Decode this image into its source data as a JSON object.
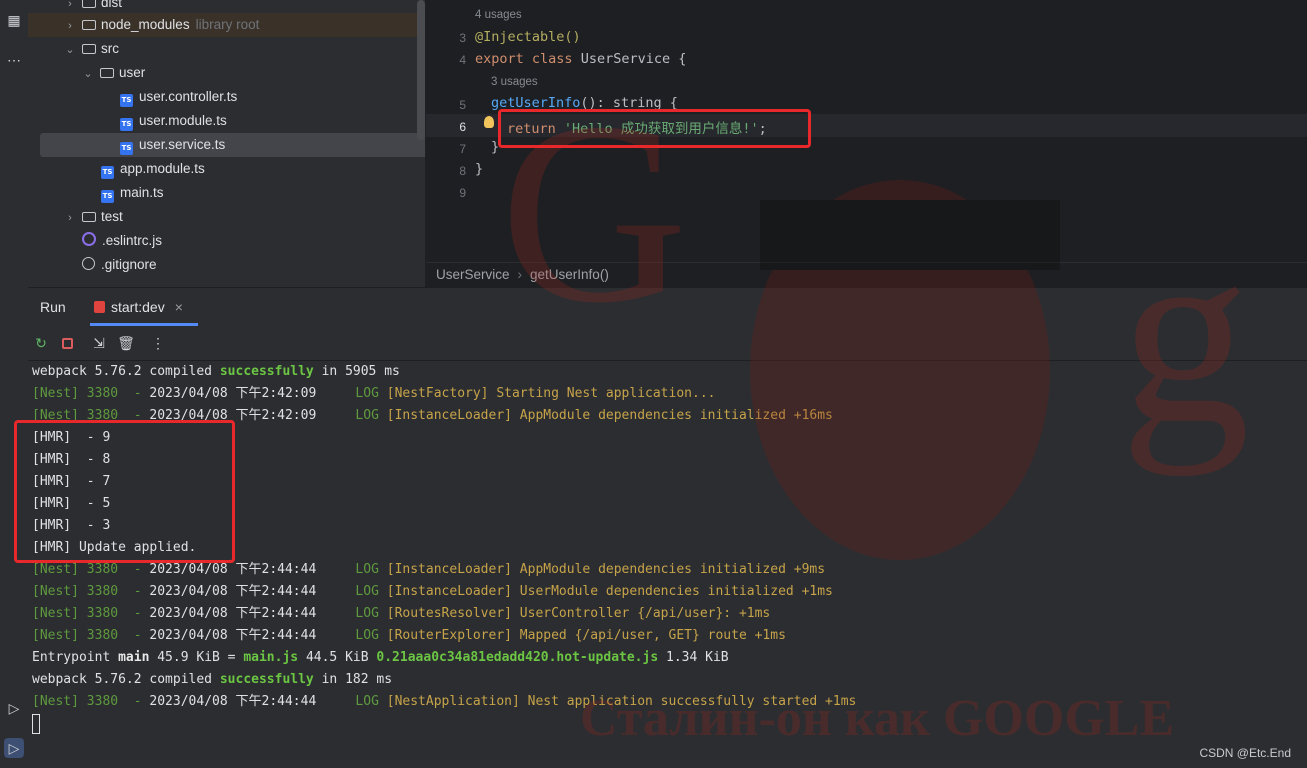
{
  "project_tree": {
    "items": [
      {
        "label": "dist",
        "kind": "folder",
        "depth": 1,
        "chevron": "›"
      },
      {
        "label": "node_modules",
        "tag": "library root",
        "kind": "folder",
        "depth": 1,
        "chevron": "›"
      },
      {
        "label": "src",
        "kind": "folder",
        "depth": 1,
        "chevron": "⌄"
      },
      {
        "label": "user",
        "kind": "folder",
        "depth": 2,
        "chevron": "⌄"
      },
      {
        "label": "user.controller.ts",
        "kind": "ts",
        "depth": 3
      },
      {
        "label": "user.module.ts",
        "kind": "ts",
        "depth": 3
      },
      {
        "label": "user.service.ts",
        "kind": "ts",
        "depth": 3,
        "selected": true
      },
      {
        "label": "app.module.ts",
        "kind": "ts",
        "depth": 2
      },
      {
        "label": "main.ts",
        "kind": "ts",
        "depth": 2
      },
      {
        "label": "test",
        "kind": "folder",
        "depth": 1,
        "chevron": "›"
      },
      {
        "label": ".eslintrc.js",
        "kind": "eslint",
        "depth": 1
      },
      {
        "label": ".gitignore",
        "kind": "ignore",
        "depth": 1
      }
    ]
  },
  "editor": {
    "usages_top": "4 usages",
    "usages_method": "3 usages",
    "line_numbers": [
      "3",
      "4",
      "5",
      "6",
      "7",
      "8",
      "9"
    ],
    "lines": {
      "l3_annotation": "@Injectable()",
      "l4_export": "export",
      "l4_class": "class",
      "l4_name": " UserService {",
      "l5_method": "getUserInfo",
      "l5_rest": "(): string {",
      "l6_return": "return",
      "l6_string": "'Hello 成功获取到用户信息!'",
      "l6_end": ";",
      "l7": "}",
      "l8": "}"
    },
    "breadcrumb": {
      "class": "UserService",
      "separator": "›",
      "method": "getUserInfo()"
    }
  },
  "run_panel": {
    "title": "Run",
    "tab_label": "start:dev",
    "tab_close": "×"
  },
  "console": {
    "webpack_1": {
      "pre": "webpack 5.76.2 compiled ",
      "status": "successfully",
      "post": " in 5905 ms"
    },
    "nest_1": {
      "prefix": "[Nest] 3380  - ",
      "time": "2023/04/08 下午2:42:09",
      "level": "     LOG ",
      "msg": "[NestFactory] Starting Nest application..."
    },
    "nest_2": {
      "prefix": "[Nest] 3380  - ",
      "time": "2023/04/08 下午2:42:09",
      "level": "     LOG ",
      "msg": "[InstanceLoader] AppModule dependencies initialized +16ms"
    },
    "hmr": [
      "[HMR]  - 9",
      "[HMR]  - 8",
      "[HMR]  - 7",
      "[HMR]  - 5",
      "[HMR]  - 3",
      "[HMR] Update applied."
    ],
    "nest_3": {
      "prefix": "[Nest] 3380  - ",
      "time": "2023/04/08 下午2:44:44",
      "level": "     LOG ",
      "msg": "[InstanceLoader] AppModule dependencies initialized +9ms"
    },
    "nest_4": {
      "prefix": "[Nest] 3380  - ",
      "time": "2023/04/08 下午2:44:44",
      "level": "     LOG ",
      "msg": "[InstanceLoader] UserModule dependencies initialized +1ms"
    },
    "nest_5": {
      "prefix": "[Nest] 3380  - ",
      "time": "2023/04/08 下午2:44:44",
      "level": "     LOG ",
      "msg": "[RoutesResolver] UserController {/api/user}: +1ms"
    },
    "nest_6": {
      "prefix": "[Nest] 3380  - ",
      "time": "2023/04/08 下午2:44:44",
      "level": "     LOG ",
      "msg": "[RouterExplorer] Mapped {/api/user, GET} route +1ms"
    },
    "entry": {
      "a": "Entrypoint ",
      "main": "main",
      "b": " 45.9 KiB = ",
      "mainjs": "main.js",
      "c": " 44.5 KiB ",
      "hot": "0.21aaa0c34a81edadd420.hot-update.js",
      "d": " 1.34 KiB"
    },
    "webpack_2": {
      "pre": "webpack 5.76.2 compiled ",
      "status": "successfully",
      "post": " in 182 ms"
    },
    "nest_7": {
      "prefix": "[Nest] 3380  - ",
      "time": "2023/04/08 下午2:44:44",
      "level": "     LOG ",
      "msg": "[NestApplication] Nest application successfully started +1ms"
    }
  },
  "background_text": "Сталин-он как GOOGLE",
  "watermark": "CSDN @Etc.End",
  "colors": {
    "highlight_box": "#e8282b",
    "accent": "#548af7",
    "success": "#6cc644",
    "log_green": "#5f9a3f"
  }
}
